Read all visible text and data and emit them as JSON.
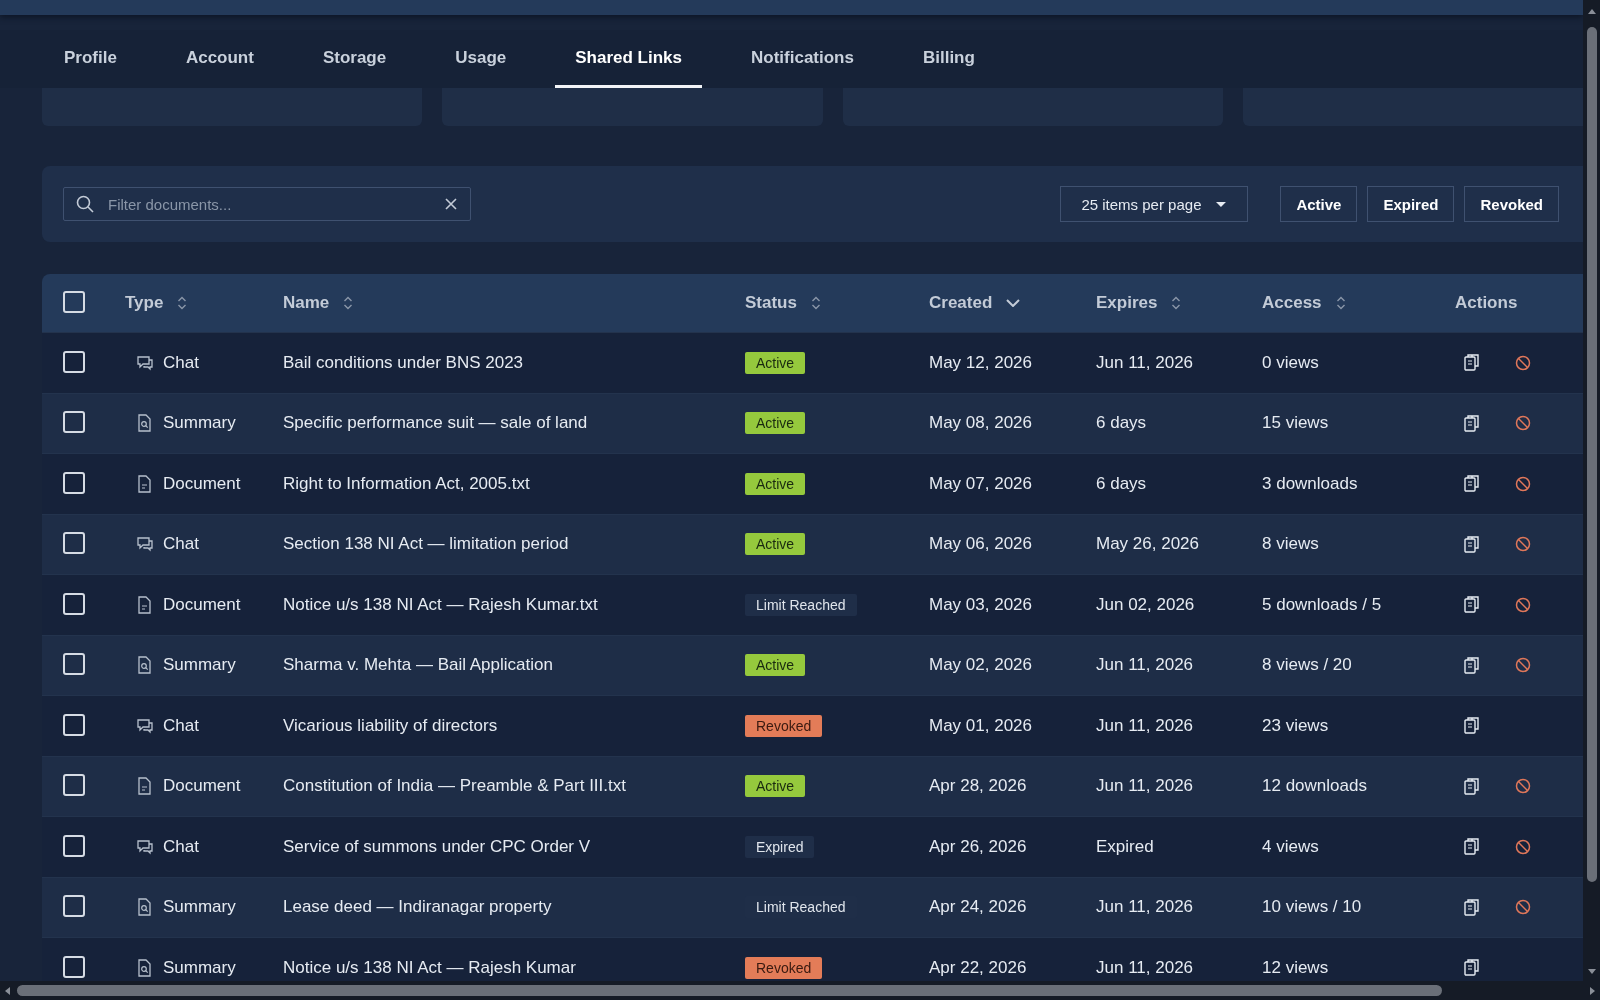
{
  "tabs": [
    {
      "label": "Profile",
      "selected": false
    },
    {
      "label": "Account",
      "selected": false
    },
    {
      "label": "Storage",
      "selected": false
    },
    {
      "label": "Usage",
      "selected": false
    },
    {
      "label": "Shared Links",
      "selected": true
    },
    {
      "label": "Notifications",
      "selected": false
    },
    {
      "label": "Billing",
      "selected": false
    }
  ],
  "filter": {
    "placeholder": "Filter documents...",
    "page_size": "25 items per page",
    "status_buttons": [
      {
        "label": "Active",
        "selected": false
      },
      {
        "label": "Expired",
        "selected": false
      },
      {
        "label": "Revoked",
        "selected": false
      }
    ]
  },
  "table": {
    "select_all": {
      "checked": false
    },
    "columns": [
      {
        "label": "Type",
        "sortable": true
      },
      {
        "label": "Name",
        "sortable": true
      },
      {
        "label": "Status",
        "sortable": true
      },
      {
        "label": "Created",
        "sortable": true,
        "sorted": true
      },
      {
        "label": "Expires",
        "sortable": true
      },
      {
        "label": "Access",
        "sortable": true
      },
      {
        "label": "Actions"
      }
    ],
    "rows": [
      {
        "checked": false,
        "type": {
          "kind": "chat",
          "label": "Chat"
        },
        "name": "Bail conditions under BNS 2023",
        "status": {
          "kind": "active",
          "label": "Active"
        },
        "created": "May 12, 2026",
        "expires": "Jun 11, 2026",
        "access": "0 views",
        "revocable": true
      },
      {
        "checked": false,
        "type": {
          "kind": "summary",
          "label": "Summary"
        },
        "name": "Specific performance suit — sale of land",
        "status": {
          "kind": "active",
          "label": "Active"
        },
        "created": "May 08, 2026",
        "expires": "6 days",
        "access": "15 views",
        "revocable": true
      },
      {
        "checked": false,
        "type": {
          "kind": "document",
          "label": "Document"
        },
        "name": "Right to Information Act, 2005.txt",
        "status": {
          "kind": "active",
          "label": "Active"
        },
        "created": "May 07, 2026",
        "expires": "6 days",
        "access": "3 downloads",
        "revocable": true
      },
      {
        "checked": false,
        "type": {
          "kind": "chat",
          "label": "Chat"
        },
        "name": "Section 138 NI Act — limitation period",
        "status": {
          "kind": "active",
          "label": "Active"
        },
        "created": "May 06, 2026",
        "expires": "May 26, 2026",
        "access": "8 views",
        "revocable": true
      },
      {
        "checked": false,
        "type": {
          "kind": "document",
          "label": "Document"
        },
        "name": "Notice u/s 138 NI Act — Rajesh Kumar.txt",
        "status": {
          "kind": "limit",
          "label": "Limit Reached"
        },
        "created": "May 03, 2026",
        "expires": "Jun 02, 2026",
        "access": "5 downloads / 5",
        "revocable": true
      },
      {
        "checked": false,
        "type": {
          "kind": "summary",
          "label": "Summary"
        },
        "name": "Sharma v. Mehta — Bail Application",
        "status": {
          "kind": "active",
          "label": "Active"
        },
        "created": "May 02, 2026",
        "expires": "Jun 11, 2026",
        "access": "8 views / 20",
        "revocable": true
      },
      {
        "checked": false,
        "type": {
          "kind": "chat",
          "label": "Chat"
        },
        "name": "Vicarious liability of directors",
        "status": {
          "kind": "revoked",
          "label": "Revoked"
        },
        "created": "May 01, 2026",
        "expires": "Jun 11, 2026",
        "access": "23 views",
        "revocable": false
      },
      {
        "checked": false,
        "type": {
          "kind": "document",
          "label": "Document"
        },
        "name": "Constitution of India — Preamble & Part III.txt",
        "status": {
          "kind": "active",
          "label": "Active"
        },
        "created": "Apr 28, 2026",
        "expires": "Jun 11, 2026",
        "access": "12 downloads",
        "revocable": true
      },
      {
        "checked": false,
        "type": {
          "kind": "chat",
          "label": "Chat"
        },
        "name": "Service of summons under CPC Order V",
        "status": {
          "kind": "expired",
          "label": "Expired"
        },
        "created": "Apr 26, 2026",
        "expires": "Expired",
        "access": "4 views",
        "revocable": true
      },
      {
        "checked": false,
        "type": {
          "kind": "summary",
          "label": "Summary"
        },
        "name": "Lease deed — Indiranagar property",
        "status": {
          "kind": "limit",
          "label": "Limit Reached"
        },
        "created": "Apr 24, 2026",
        "expires": "Jun 11, 2026",
        "access": "10 views / 10",
        "revocable": true
      },
      {
        "checked": false,
        "type": {
          "kind": "summary",
          "label": "Summary"
        },
        "name": "Notice u/s 138 NI Act — Rajesh Kumar",
        "status": {
          "kind": "revoked",
          "label": "Revoked"
        },
        "created": "Apr 22, 2026",
        "expires": "Jun 11, 2026",
        "access": "12 views",
        "revocable": false
      }
    ]
  }
}
